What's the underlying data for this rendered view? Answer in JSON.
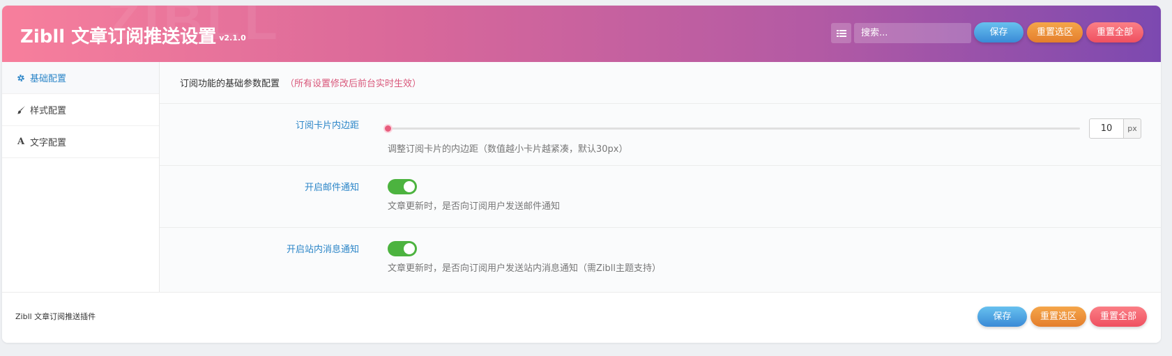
{
  "header": {
    "title": "Zibll 文章订阅推送设置",
    "version": "v2.1.0",
    "watermark": "ZIBLL",
    "search_placeholder": "搜索...",
    "save_label": "保存",
    "reset_section_label": "重置选区",
    "reset_all_label": "重置全部"
  },
  "sidebar": {
    "items": [
      {
        "label": "基础配置",
        "icon": "gear-icon",
        "active": true
      },
      {
        "label": "样式配置",
        "icon": "brush-icon",
        "active": false
      },
      {
        "label": "文字配置",
        "icon": "font-icon",
        "active": false
      }
    ]
  },
  "main": {
    "section_title": "订阅功能的基础参数配置",
    "section_note": "（所有设置修改后前台实时生效）",
    "fields": [
      {
        "label": "订阅卡片内边距",
        "type": "slider",
        "value": "10",
        "unit": "px",
        "slider_fraction": 0.0,
        "description": "调整订阅卡片的内边距（数值越小卡片越紧凑，默认30px）"
      },
      {
        "label": "开启邮件通知",
        "type": "toggle",
        "on": true,
        "description": "文章更新时，是否向订阅用户发送邮件通知"
      },
      {
        "label": "开启站内消息通知",
        "type": "toggle",
        "on": true,
        "description": "文章更新时，是否向订阅用户发送站内消息通知（需Zibll主题支持）"
      }
    ]
  },
  "footer": {
    "text": "Zibll 文章订阅推送插件",
    "save_label": "保存",
    "reset_section_label": "重置选区",
    "reset_all_label": "重置全部"
  },
  "colors": {
    "accent_blue": "#2c86c8",
    "note_pink": "#d9577a",
    "toggle_green": "#4cb33f",
    "slider_thumb": "#e85c7d"
  }
}
